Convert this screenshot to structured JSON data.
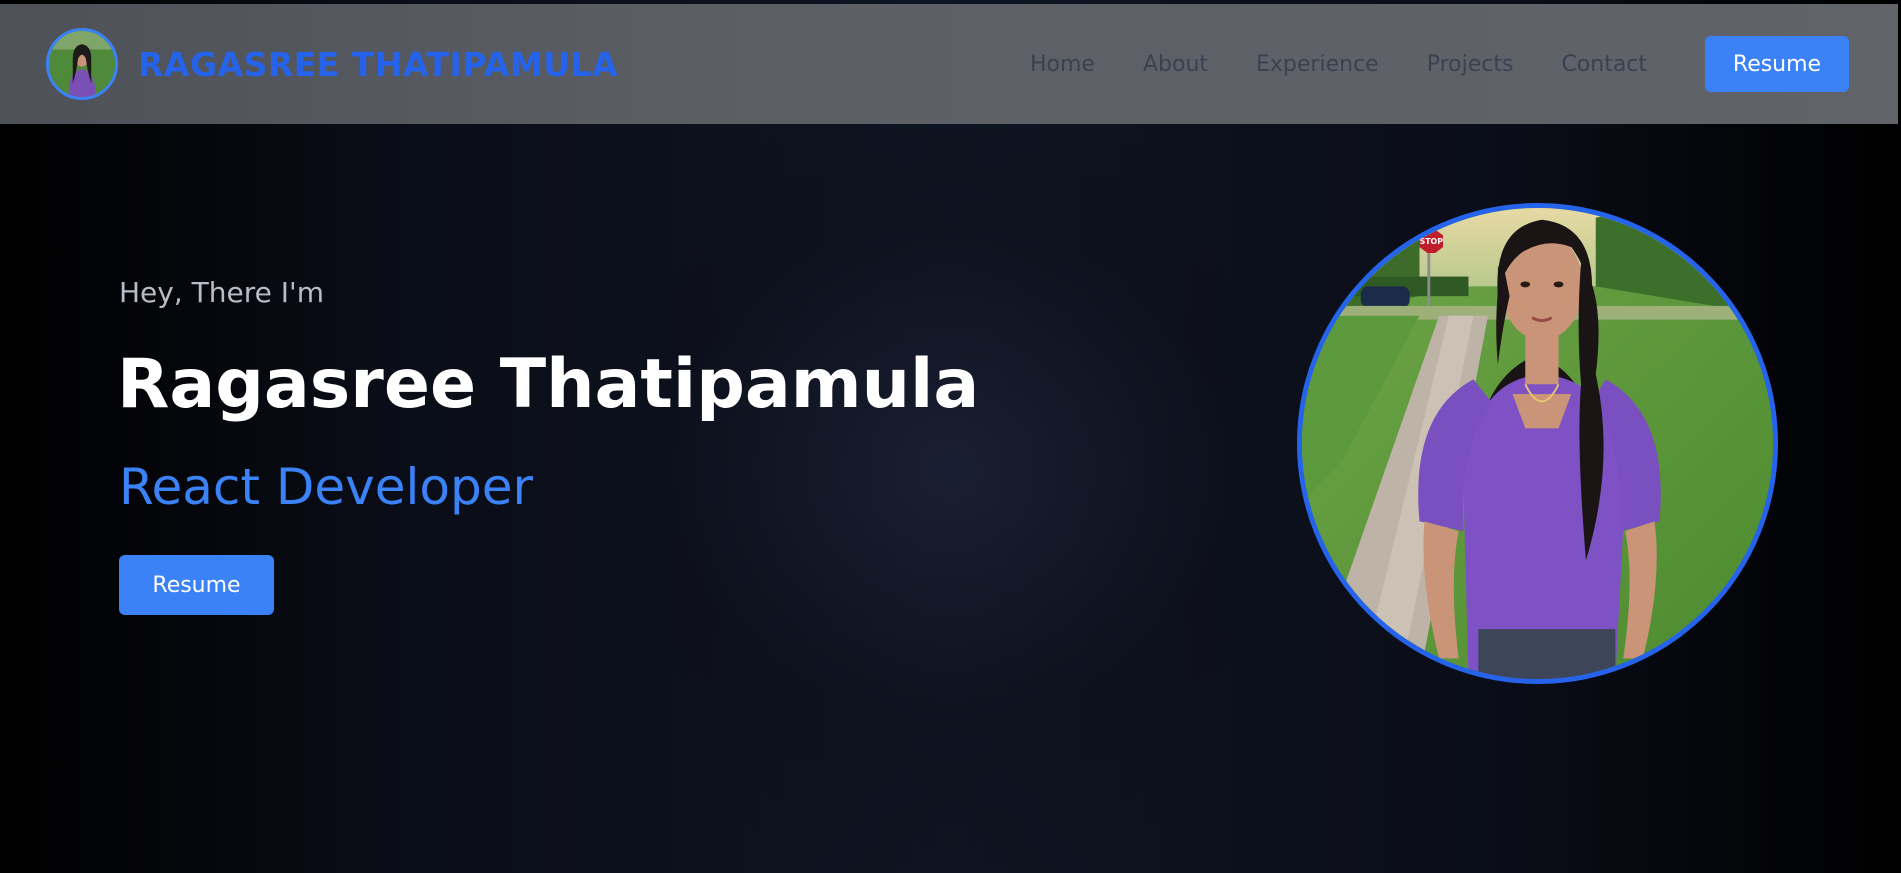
{
  "header": {
    "brand_name": "RAGASREE THATIPAMULA",
    "nav": [
      {
        "label": "Home"
      },
      {
        "label": "About"
      },
      {
        "label": "Experience"
      },
      {
        "label": "Projects"
      },
      {
        "label": "Contact"
      }
    ],
    "resume_label": "Resume"
  },
  "hero": {
    "intro": "Hey, There I'm",
    "name": "Ragasree Thatipamula",
    "role": "React Developer",
    "resume_label": "Resume"
  },
  "photo": {
    "sign_text": "STOP"
  },
  "colors": {
    "accent": "#3b82f6",
    "brand": "#2563eb",
    "navbar_bg": "#5c5f66",
    "nav_text": "#3a4150",
    "page_bg": "#0f1422"
  }
}
